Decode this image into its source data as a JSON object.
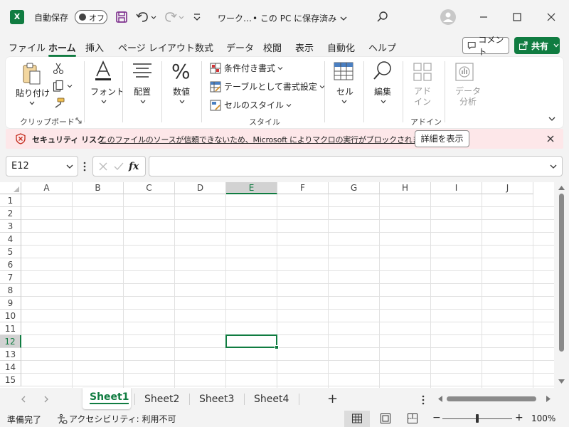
{
  "titlebar": {
    "app_icon": "X",
    "autosave_label": "自動保存",
    "autosave_state": "オフ",
    "doc_title": "ワーク…",
    "save_status": "• この PC に保存済み",
    "icons": [
      "save-icon",
      "undo-icon",
      "redo-icon",
      "customize-icon",
      "search-icon",
      "user-icon",
      "minimize-icon",
      "maximize-icon",
      "close-icon"
    ]
  },
  "menu": {
    "tabs": [
      "ファイル",
      "ホーム",
      "挿入",
      "ページ レイアウト",
      "数式",
      "データ",
      "校閲",
      "表示",
      "自動化",
      "ヘルプ"
    ],
    "active": "ホーム",
    "comment_label": "コメント",
    "share_label": "共有"
  },
  "ribbon": {
    "paste": "貼り付け",
    "clipboard_group": "クリップボード",
    "font": "フォント",
    "alignment": "配置",
    "number": "数値",
    "conditional_format": "条件付き書式",
    "format_as_table": "テーブルとして書式設定",
    "cell_styles": "セルのスタイル",
    "styles_group": "スタイル",
    "cells": "セル",
    "editing": "編集",
    "addins": "アド\nイン",
    "addins_group": "アドイン",
    "data_analysis": "データ\n分析"
  },
  "security": {
    "title": "セキュリティ リスク",
    "message": "このファイルのソースが信頼できないため、Microsoft によりマクロの実行がブロックされました。",
    "button": "詳細を表示"
  },
  "formula_bar": {
    "name_box": "E12",
    "fx": "fx",
    "value": ""
  },
  "grid": {
    "columns": [
      "A",
      "B",
      "C",
      "D",
      "E",
      "F",
      "G",
      "H",
      "I",
      "J"
    ],
    "rows": [
      "1",
      "2",
      "3",
      "4",
      "5",
      "6",
      "7",
      "8",
      "9",
      "10",
      "11",
      "12",
      "13",
      "14",
      "15"
    ],
    "selected_cell": "E12",
    "accent": "#107c41"
  },
  "sheets": {
    "tabs": [
      "Sheet1",
      "Sheet2",
      "Sheet3",
      "Sheet4"
    ],
    "active": "Sheet1",
    "add": "+"
  },
  "status": {
    "ready": "準備完了",
    "accessibility": "アクセシビリティ: 利用不可",
    "zoom": "100%",
    "zoom_minus": "−",
    "zoom_plus": "+"
  }
}
